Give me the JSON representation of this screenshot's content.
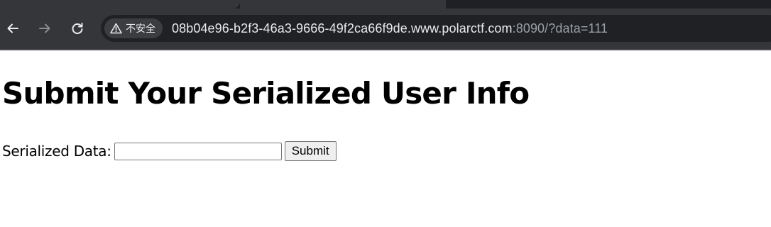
{
  "browser": {
    "security_label": "不安全",
    "url_host": "08b04e96-b2f3-46a3-9666-49f2ca66f9de.www.polarctf.com",
    "url_rest": ":8090/?data=111",
    "icons": {
      "back": "back-arrow-icon",
      "forward": "forward-arrow-icon",
      "reload": "reload-icon",
      "security": "warning-triangle-icon"
    }
  },
  "page": {
    "title": "Submit Your Serialized User Info",
    "form": {
      "label": "Serialized Data:",
      "input_value": "",
      "submit_label": "Submit"
    }
  }
}
